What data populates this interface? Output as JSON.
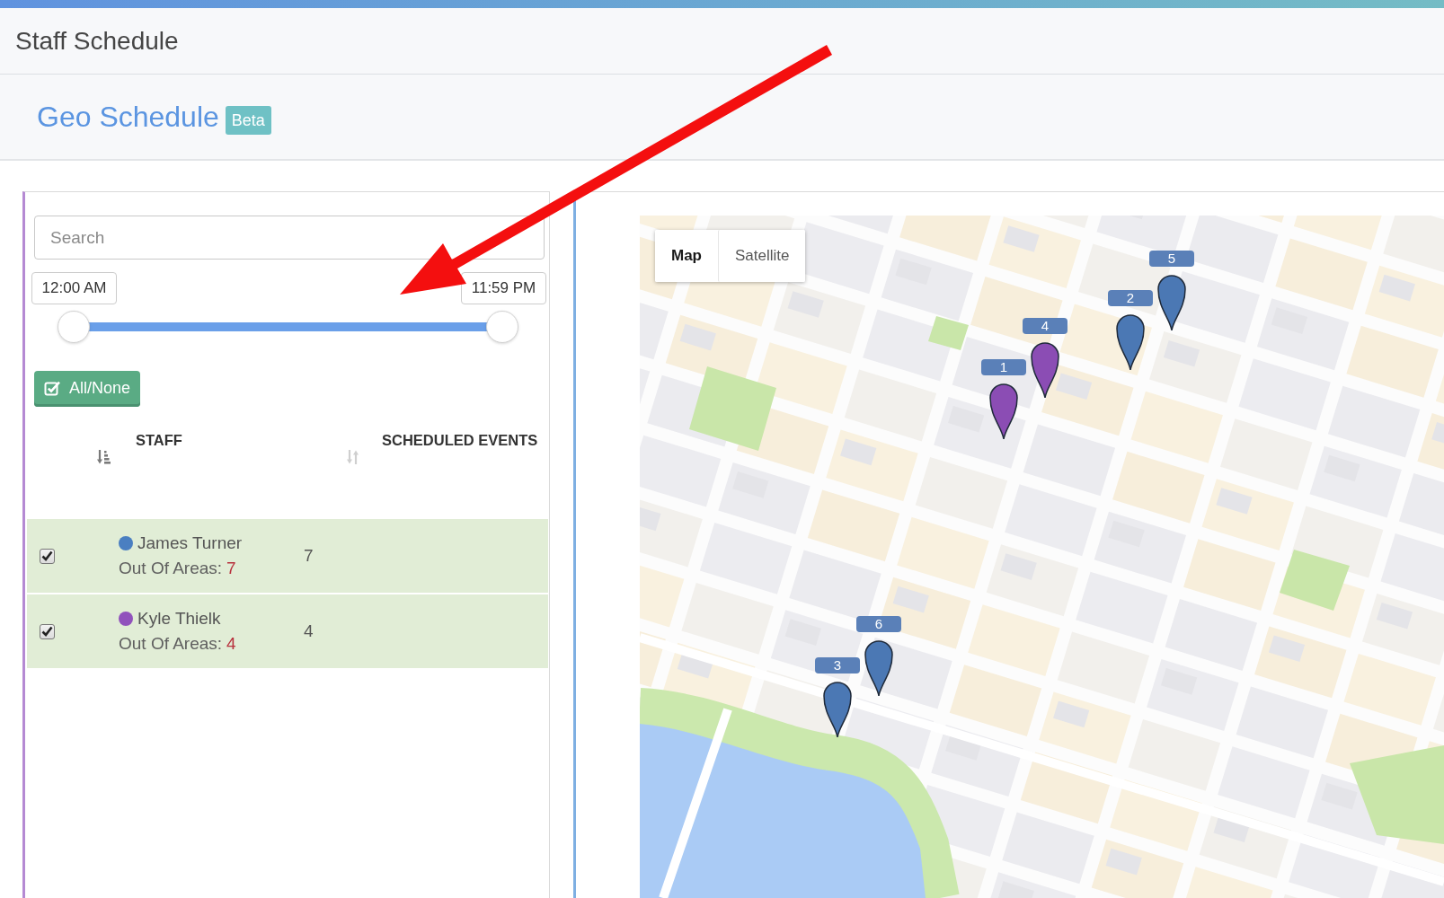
{
  "window": {
    "title": "Staff Schedule"
  },
  "page_header": {
    "title": "Geo Schedule",
    "badge": "Beta"
  },
  "filters": {
    "search": {
      "placeholder": "Search"
    },
    "time_range": {
      "handles": [
        {
          "label": "12:00 AM",
          "level": 0
        },
        {
          "label": "11:59 PM",
          "level": 1
        }
      ]
    },
    "all_none_button": {
      "label": "All/None"
    }
  },
  "staff_table": {
    "columns": [
      {
        "label": "STAFF",
        "sorted": true
      },
      {
        "label": "SCHEDULED EVENTS",
        "sorted": false
      }
    ],
    "rows": [
      {
        "checked": true,
        "color": "#4a7fc1",
        "name": "James Turner",
        "out_of_areas_label": "Out Of Areas:",
        "out_of_areas": "7",
        "scheduled_events": "7"
      },
      {
        "checked": true,
        "color": "#9152bc",
        "name": "Kyle Thielk",
        "out_of_areas_label": "Out Of Areas:",
        "out_of_areas": "4",
        "scheduled_events": "4"
      }
    ]
  },
  "map": {
    "type_tabs": [
      {
        "label": "Map",
        "selected": true
      },
      {
        "label": "Satellite",
        "selected": false
      }
    ],
    "markers": [
      {
        "label": "5",
        "color": "#4b78b4"
      },
      {
        "label": "2",
        "color": "#4b78b4"
      },
      {
        "label": "4",
        "color": "#8b4db4"
      },
      {
        "label": "1",
        "color": "#8b4db4"
      },
      {
        "label": "6",
        "color": "#4b78b4"
      },
      {
        "label": "3",
        "color": "#4b78b4"
      }
    ]
  }
}
